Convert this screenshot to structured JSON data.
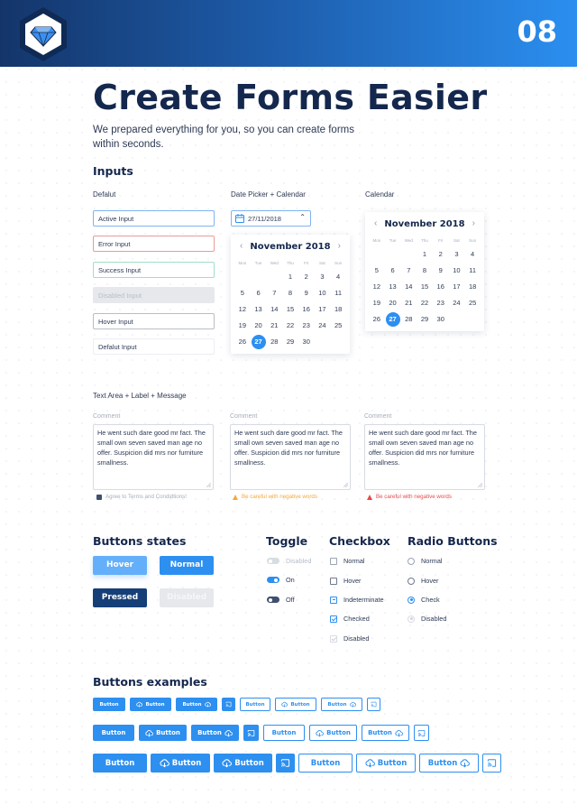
{
  "header": {
    "page_number": "08",
    "logo_icon": "sketch-diamond-icon",
    "colors": {
      "gradient_start": "#14356a",
      "gradient_end": "#2b8ff0"
    }
  },
  "hero": {
    "title": "Create Forms Easier",
    "subtitle": "We prepared everything for you, so you can create forms within seconds."
  },
  "inputs": {
    "heading": "Inputs",
    "default_col": {
      "label": "Defalut",
      "fields": [
        {
          "state": "active",
          "value": "Active Input"
        },
        {
          "state": "error",
          "value": "Error Input"
        },
        {
          "state": "success",
          "value": "Success Input"
        },
        {
          "state": "disabled",
          "value": "Disabled Input"
        },
        {
          "state": "hover",
          "value": "Hover Input"
        },
        {
          "state": "default",
          "value": "Defalut Input"
        }
      ]
    },
    "datepicker_col": {
      "label": "Date Picker + Calendar",
      "value": "27/11/2018"
    },
    "calendar_col": {
      "label": "Calendar"
    },
    "calendar": {
      "month": "November 2018",
      "weekdays": [
        "Mon",
        "Tue",
        "Wed",
        "Thu",
        "Fri",
        "Sat",
        "Sun"
      ],
      "leading_blanks": 3,
      "days": 30,
      "selected": 27
    }
  },
  "textareas": {
    "heading": "Text Area + Label + Message",
    "items": [
      {
        "label": "Comment",
        "value": "He went such dare good mr fact. The small own seven saved man age no offer. Suspicion did mrs nor furniture smallness.",
        "message": "Agree to Terms and Condidtions!",
        "message_type": "info"
      },
      {
        "label": "Comment",
        "value": "He went such dare good mr fact. The small own seven saved man age no offer. Suspicion did mrs nor furniture smallness.",
        "message": "Be careful with negative words",
        "message_type": "warning"
      },
      {
        "label": "Comment",
        "value": "He went such dare good mr fact. The small own seven saved man age no offer. Suspicion did mrs nor furniture smallness.",
        "message": "Be careful with negative words",
        "message_type": "error"
      }
    ]
  },
  "button_states": {
    "heading": "Buttons states",
    "hover": "Hover",
    "normal": "Normal",
    "pressed": "Pressed",
    "disabled": "Disabled"
  },
  "toggle": {
    "heading": "Toggle",
    "items": [
      {
        "label": "Disabled",
        "state": "disabled"
      },
      {
        "label": "On",
        "state": "on"
      },
      {
        "label": "Off",
        "state": "off"
      }
    ]
  },
  "checkbox": {
    "heading": "Checkbox",
    "items": [
      {
        "label": "Normal",
        "state": "normal"
      },
      {
        "label": "Hover",
        "state": "hover"
      },
      {
        "label": "Indeterminate",
        "state": "indeterminate"
      },
      {
        "label": "Checked",
        "state": "checked"
      },
      {
        "label": "Disabled",
        "state": "disabled"
      }
    ]
  },
  "radio": {
    "heading": "Radio  Buttons",
    "items": [
      {
        "label": "Normal",
        "state": "normal"
      },
      {
        "label": "Hover",
        "state": "hover"
      },
      {
        "label": "Check",
        "state": "checked"
      },
      {
        "label": "Disabled",
        "state": "disabled"
      }
    ]
  },
  "button_examples": {
    "heading": "Buttons examples",
    "label": "Button",
    "colors": {
      "primary": "#2d8ff0"
    }
  }
}
